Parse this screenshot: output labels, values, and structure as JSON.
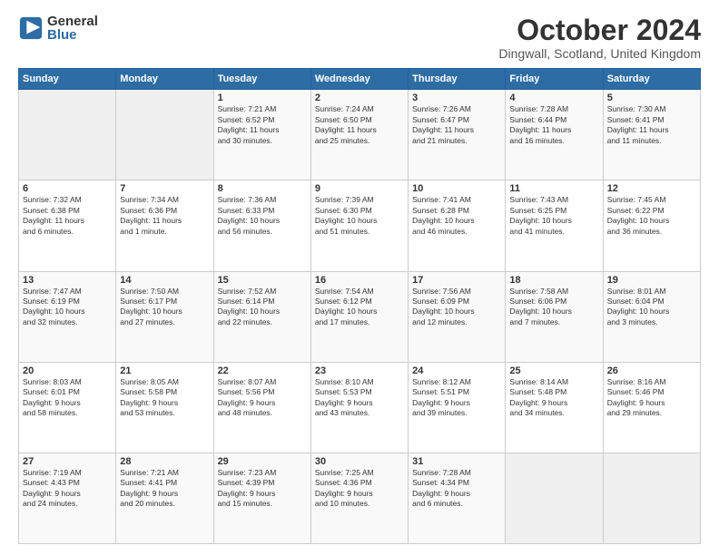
{
  "logo": {
    "general": "General",
    "blue": "Blue"
  },
  "title": "October 2024",
  "location": "Dingwall, Scotland, United Kingdom",
  "days_of_week": [
    "Sunday",
    "Monday",
    "Tuesday",
    "Wednesday",
    "Thursday",
    "Friday",
    "Saturday"
  ],
  "weeks": [
    [
      {
        "day": "",
        "info": ""
      },
      {
        "day": "",
        "info": ""
      },
      {
        "day": "1",
        "info": "Sunrise: 7:21 AM\nSunset: 6:52 PM\nDaylight: 11 hours\nand 30 minutes."
      },
      {
        "day": "2",
        "info": "Sunrise: 7:24 AM\nSunset: 6:50 PM\nDaylight: 11 hours\nand 25 minutes."
      },
      {
        "day": "3",
        "info": "Sunrise: 7:26 AM\nSunset: 6:47 PM\nDaylight: 11 hours\nand 21 minutes."
      },
      {
        "day": "4",
        "info": "Sunrise: 7:28 AM\nSunset: 6:44 PM\nDaylight: 11 hours\nand 16 minutes."
      },
      {
        "day": "5",
        "info": "Sunrise: 7:30 AM\nSunset: 6:41 PM\nDaylight: 11 hours\nand 11 minutes."
      }
    ],
    [
      {
        "day": "6",
        "info": "Sunrise: 7:32 AM\nSunset: 6:38 PM\nDaylight: 11 hours\nand 6 minutes."
      },
      {
        "day": "7",
        "info": "Sunrise: 7:34 AM\nSunset: 6:36 PM\nDaylight: 11 hours\nand 1 minute."
      },
      {
        "day": "8",
        "info": "Sunrise: 7:36 AM\nSunset: 6:33 PM\nDaylight: 10 hours\nand 56 minutes."
      },
      {
        "day": "9",
        "info": "Sunrise: 7:39 AM\nSunset: 6:30 PM\nDaylight: 10 hours\nand 51 minutes."
      },
      {
        "day": "10",
        "info": "Sunrise: 7:41 AM\nSunset: 6:28 PM\nDaylight: 10 hours\nand 46 minutes."
      },
      {
        "day": "11",
        "info": "Sunrise: 7:43 AM\nSunset: 6:25 PM\nDaylight: 10 hours\nand 41 minutes."
      },
      {
        "day": "12",
        "info": "Sunrise: 7:45 AM\nSunset: 6:22 PM\nDaylight: 10 hours\nand 36 minutes."
      }
    ],
    [
      {
        "day": "13",
        "info": "Sunrise: 7:47 AM\nSunset: 6:19 PM\nDaylight: 10 hours\nand 32 minutes."
      },
      {
        "day": "14",
        "info": "Sunrise: 7:50 AM\nSunset: 6:17 PM\nDaylight: 10 hours\nand 27 minutes."
      },
      {
        "day": "15",
        "info": "Sunrise: 7:52 AM\nSunset: 6:14 PM\nDaylight: 10 hours\nand 22 minutes."
      },
      {
        "day": "16",
        "info": "Sunrise: 7:54 AM\nSunset: 6:12 PM\nDaylight: 10 hours\nand 17 minutes."
      },
      {
        "day": "17",
        "info": "Sunrise: 7:56 AM\nSunset: 6:09 PM\nDaylight: 10 hours\nand 12 minutes."
      },
      {
        "day": "18",
        "info": "Sunrise: 7:58 AM\nSunset: 6:06 PM\nDaylight: 10 hours\nand 7 minutes."
      },
      {
        "day": "19",
        "info": "Sunrise: 8:01 AM\nSunset: 6:04 PM\nDaylight: 10 hours\nand 3 minutes."
      }
    ],
    [
      {
        "day": "20",
        "info": "Sunrise: 8:03 AM\nSunset: 6:01 PM\nDaylight: 9 hours\nand 58 minutes."
      },
      {
        "day": "21",
        "info": "Sunrise: 8:05 AM\nSunset: 5:58 PM\nDaylight: 9 hours\nand 53 minutes."
      },
      {
        "day": "22",
        "info": "Sunrise: 8:07 AM\nSunset: 5:56 PM\nDaylight: 9 hours\nand 48 minutes."
      },
      {
        "day": "23",
        "info": "Sunrise: 8:10 AM\nSunset: 5:53 PM\nDaylight: 9 hours\nand 43 minutes."
      },
      {
        "day": "24",
        "info": "Sunrise: 8:12 AM\nSunset: 5:51 PM\nDaylight: 9 hours\nand 39 minutes."
      },
      {
        "day": "25",
        "info": "Sunrise: 8:14 AM\nSunset: 5:48 PM\nDaylight: 9 hours\nand 34 minutes."
      },
      {
        "day": "26",
        "info": "Sunrise: 8:16 AM\nSunset: 5:46 PM\nDaylight: 9 hours\nand 29 minutes."
      }
    ],
    [
      {
        "day": "27",
        "info": "Sunrise: 7:19 AM\nSunset: 4:43 PM\nDaylight: 9 hours\nand 24 minutes."
      },
      {
        "day": "28",
        "info": "Sunrise: 7:21 AM\nSunset: 4:41 PM\nDaylight: 9 hours\nand 20 minutes."
      },
      {
        "day": "29",
        "info": "Sunrise: 7:23 AM\nSunset: 4:39 PM\nDaylight: 9 hours\nand 15 minutes."
      },
      {
        "day": "30",
        "info": "Sunrise: 7:25 AM\nSunset: 4:36 PM\nDaylight: 9 hours\nand 10 minutes."
      },
      {
        "day": "31",
        "info": "Sunrise: 7:28 AM\nSunset: 4:34 PM\nDaylight: 9 hours\nand 6 minutes."
      },
      {
        "day": "",
        "info": ""
      },
      {
        "day": "",
        "info": ""
      }
    ]
  ]
}
